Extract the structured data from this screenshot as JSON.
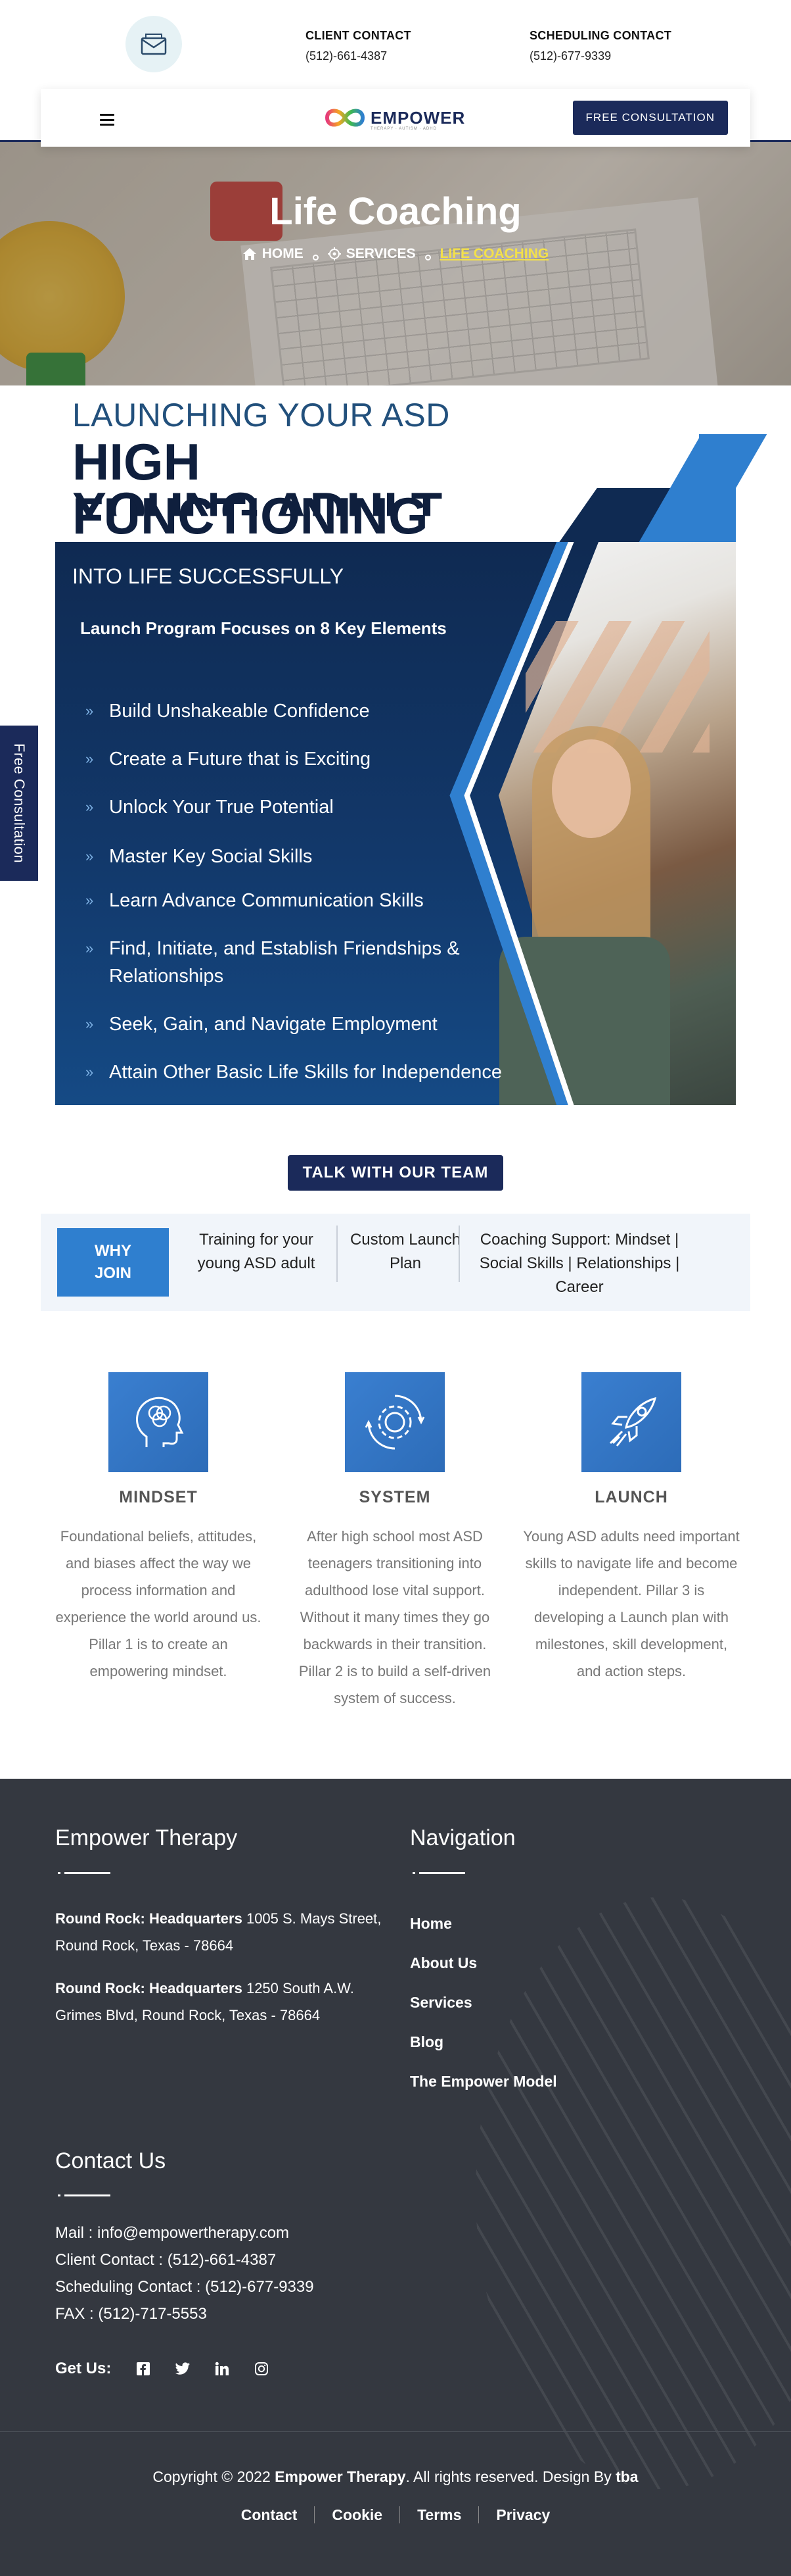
{
  "header": {
    "client_contact_label": "CLIENT CONTACT",
    "client_contact_phone": "(512)-661-4387",
    "scheduling_contact_label": "SCHEDULING CONTACT",
    "scheduling_contact_phone": "(512)-677-9339"
  },
  "nav": {
    "logo_text": "EMPOWER",
    "logo_tagline": "THERAPY · AUTISM · ADHD",
    "cta_label": "FREE CONSULTATION"
  },
  "hero": {
    "title": "Life Coaching",
    "breadcrumb": [
      "HOME",
      "SERVICES",
      "LIFE COACHING"
    ]
  },
  "side_tab": {
    "label": "Free Consultation"
  },
  "launch": {
    "heading_line1": "LAUNCHING YOUR ASD",
    "heading_line2": "HIGH",
    "heading_line3": "YOUNG ADULT",
    "heading_line3_overlap": "FUNCTIONING",
    "heading_line4": "INTO LIFE SUCCESSFULLY",
    "focus_title": "Launch Program Focuses on 8 Key Elements",
    "elements": [
      "Build Unshakeable Confidence",
      "Create a Future that is Exciting",
      "Unlock Your True Potential",
      "Master Key Social Skills",
      "Learn Advance Communication Skills",
      "Find, Initiate, and Establish Friendships & Relationships",
      "Seek, Gain, and Navigate Employment",
      "Attain Other Basic Life Skills for Independence"
    ]
  },
  "talk_button": "TALK WITH OUR TEAM",
  "why_join": {
    "badge": "WHY JOIN",
    "items": [
      "Training for your young ASD adult",
      "Custom Launch Plan",
      "Coaching Support: Mindset | Social Skills | Relationships | Career"
    ]
  },
  "pillars": [
    {
      "icon": "head-brain-icon",
      "title": "MINDSET",
      "text": "Foundational beliefs, attitudes, and biases affect the way we process information and experience the world around us. Pillar 1 is to create an empowering mindset."
    },
    {
      "icon": "gear-cycle-icon",
      "title": "SYSTEM",
      "text": "After high school most ASD teenagers transitioning into adulthood lose vital support. Without it many times they go backwards in their transition. Pillar 2 is to build a self-driven system of success."
    },
    {
      "icon": "rocket-icon",
      "title": "LAUNCH",
      "text": "Young ASD adults need important skills to navigate life and become independent. Pillar 3 is developing a Launch plan with milestones, skill development, and action steps."
    }
  ],
  "footer": {
    "brand_heading": "Empower Therapy",
    "addresses": [
      {
        "name": "Round Rock: Headquarters",
        "address": "1005 S. Mays Street, Round Rock, Texas - 78664"
      },
      {
        "name": "Round Rock: Headquarters",
        "address": "1250 South A.W. Grimes Blvd, Round Rock, Texas - 78664"
      }
    ],
    "nav_heading": "Navigation",
    "nav_items": [
      "Home",
      "About Us",
      "Services",
      "Blog",
      "The Empower Model"
    ],
    "contact_heading": "Contact Us",
    "contact_lines": [
      "Mail : info@empowertherapy.com",
      "Client Contact : (512)-661-4387",
      "Scheduling Contact : (512)-677-9339",
      "FAX : (512)-717-5553"
    ],
    "social_label": "Get Us:",
    "social": [
      "facebook-icon",
      "twitter-icon",
      "linkedin-icon",
      "instagram-icon"
    ],
    "copyright_prefix": "Copyright © 2022",
    "copyright_brand": "Empower Therapy",
    "copyright_middle": ". All rights reserved. Design By",
    "copyright_designer": "tba",
    "links": [
      "Contact",
      "Cookie",
      "Terms",
      "Privacy"
    ]
  },
  "colors": {
    "navy": "#1b2a5a",
    "accent_blue": "#2f7fcf",
    "footer_bg": "#343840",
    "breadcrumb_active": "#f3e04a"
  }
}
